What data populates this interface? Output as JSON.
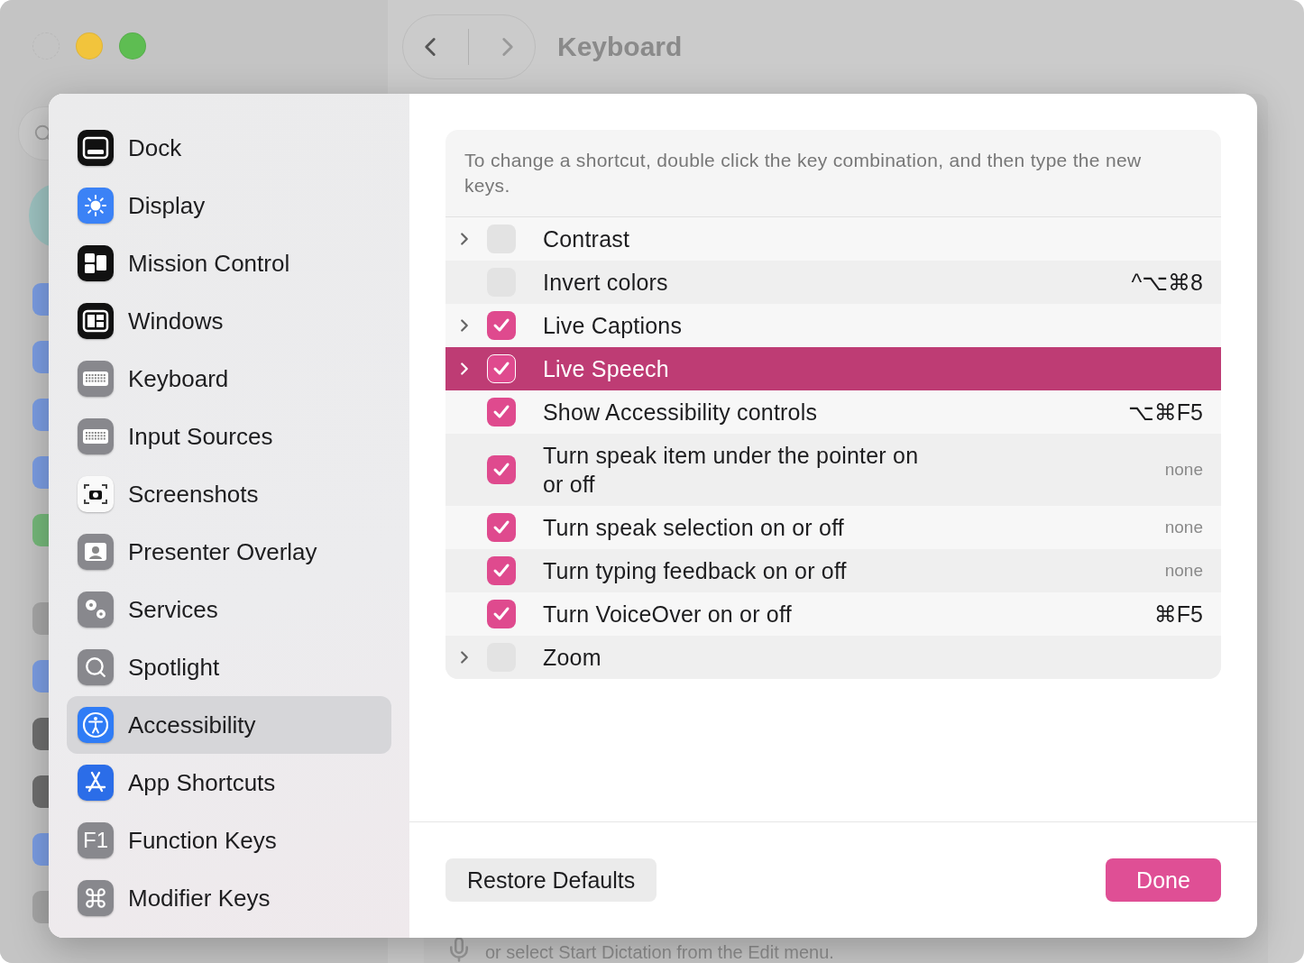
{
  "background_window": {
    "title": "Keyboard",
    "dictation_hint": "or select Start Dictation from the Edit menu."
  },
  "sheet": {
    "sidebar": {
      "items": [
        {
          "label": "Dock",
          "selected": false
        },
        {
          "label": "Display",
          "selected": false
        },
        {
          "label": "Mission Control",
          "selected": false
        },
        {
          "label": "Windows",
          "selected": false
        },
        {
          "label": "Keyboard",
          "selected": false
        },
        {
          "label": "Input Sources",
          "selected": false
        },
        {
          "label": "Screenshots",
          "selected": false
        },
        {
          "label": "Presenter Overlay",
          "selected": false
        },
        {
          "label": "Services",
          "selected": false
        },
        {
          "label": "Spotlight",
          "selected": false
        },
        {
          "label": "Accessibility",
          "selected": true
        },
        {
          "label": "App Shortcuts",
          "selected": false
        },
        {
          "label": "Function Keys",
          "icon_text": "F1",
          "selected": false
        },
        {
          "label": "Modifier Keys",
          "selected": false
        }
      ]
    },
    "shortcuts": {
      "hint": "To change a shortcut, double click the key combination, and then type the new keys.",
      "rows": [
        {
          "label": "Contrast",
          "expandable": true,
          "checked": false,
          "selected": false
        },
        {
          "label": "Invert colors",
          "expandable": false,
          "checked": false,
          "selected": false,
          "shortcut": "^⌥⌘8",
          "shortcut_set": true
        },
        {
          "label": "Live Captions",
          "expandable": true,
          "checked": true,
          "selected": false
        },
        {
          "label": "Live Speech",
          "expandable": true,
          "checked": true,
          "selected": true
        },
        {
          "label": "Show Accessibility controls",
          "expandable": false,
          "checked": true,
          "selected": false,
          "shortcut": "⌥⌘F5",
          "shortcut_set": true
        },
        {
          "label": "Turn speak item under the pointer on or off",
          "expandable": false,
          "checked": true,
          "selected": false,
          "shortcut": "none",
          "shortcut_set": false
        },
        {
          "label": "Turn speak selection on or off",
          "expandable": false,
          "checked": true,
          "selected": false,
          "shortcut": "none",
          "shortcut_set": false
        },
        {
          "label": "Turn typing feedback on or off",
          "expandable": false,
          "checked": true,
          "selected": false,
          "shortcut": "none",
          "shortcut_set": false
        },
        {
          "label": "Turn VoiceOver on or off",
          "expandable": false,
          "checked": true,
          "selected": false,
          "shortcut": "⌘F5",
          "shortcut_set": true
        },
        {
          "label": "Zoom",
          "expandable": true,
          "checked": false,
          "selected": false
        }
      ]
    },
    "buttons": [
      {
        "label": "Restore Defaults",
        "kind": "secondary"
      },
      {
        "label": "Done",
        "kind": "primary"
      }
    ]
  }
}
